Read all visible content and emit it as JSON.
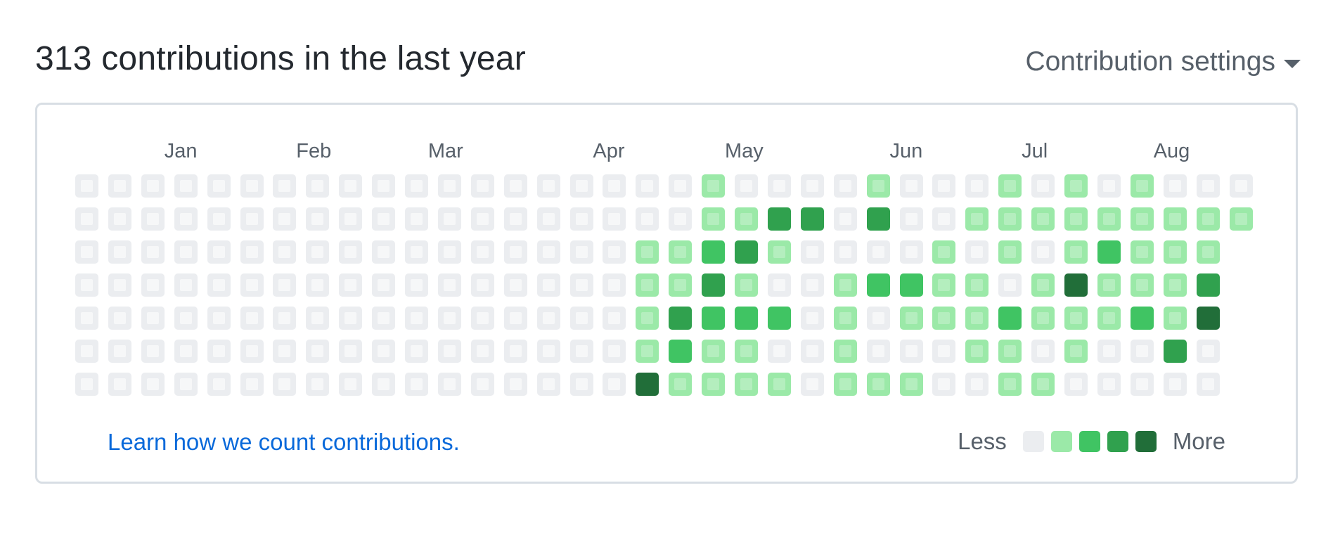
{
  "header": {
    "title": "313 contributions in the last year",
    "settings_label": "Contribution settings"
  },
  "months": [
    {
      "label": "Jan",
      "week": 3
    },
    {
      "label": "Feb",
      "week": 7
    },
    {
      "label": "Mar",
      "week": 11
    },
    {
      "label": "Apr",
      "week": 16
    },
    {
      "label": "May",
      "week": 20
    },
    {
      "label": "Jun",
      "week": 25
    },
    {
      "label": "Jul",
      "week": 29
    },
    {
      "label": "Aug",
      "week": 33
    }
  ],
  "colors": [
    "#ebedf0",
    "#9be9a8",
    "#40c463",
    "#30a14e",
    "#216e39"
  ],
  "weeks": 36,
  "levels": [
    "0000000000000000000100001000101010000",
    "000000000000000000011330300111111111",
    "00000000000000000112310000101012111",
    "00000000000000000113100122110141113",
    "00000000000000000132220101112111214",
    "00000000000000000121100100011010030",
    "00000000000000000411110111001100000"
  ],
  "footer": {
    "learn_link": "Learn how we count contributions.",
    "less_label": "Less",
    "more_label": "More"
  }
}
